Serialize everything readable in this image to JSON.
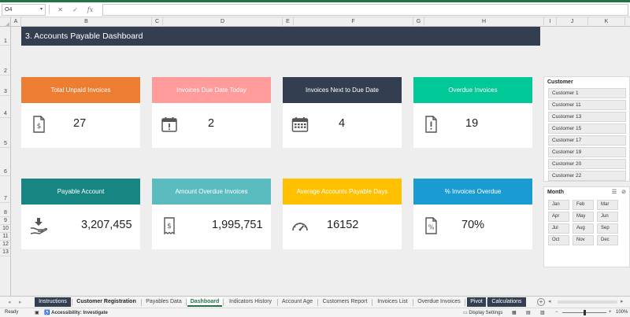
{
  "formula_bar": {
    "name_box": "O4",
    "cancel_icon": "✕",
    "enter_icon": "✓",
    "fx": "fx",
    "formula": ""
  },
  "columns": [
    "A",
    "B",
    "C",
    "D",
    "E",
    "F",
    "G",
    "H",
    "I",
    "J",
    "K"
  ],
  "rows": [
    "1",
    "2",
    "3",
    "4",
    "5",
    "6",
    "7",
    "8",
    "9",
    "10",
    "11",
    "12",
    "13"
  ],
  "dashboard": {
    "title": "3. Accounts Payable Dashboard",
    "cards": [
      {
        "label": "Total Unpaid Invoices",
        "value": "27",
        "color": "#ed7d31",
        "icon": "invoice-icon"
      },
      {
        "label": "Invoices Due Date Today",
        "value": "2",
        "color": "#ff9b9b",
        "icon": "calendar-icon"
      },
      {
        "label": "Invoices Next to Due Date",
        "value": "4",
        "color": "#333f50",
        "icon": "calendar-grid-icon"
      },
      {
        "label": "Overdue Invoices",
        "value": "19",
        "color": "#00c896",
        "icon": "alert-document-icon"
      },
      {
        "label": "Payable Account",
        "value": "3,207,455",
        "color": "#178683",
        "icon": "hand-money-icon"
      },
      {
        "label": "Amount Overdue Invoices",
        "value": "1,995,751",
        "color": "#5bbcc0",
        "icon": "receipt-icon"
      },
      {
        "label": "Average Accounts Payable Days",
        "value": "16152",
        "color": "#ffc000",
        "icon": "speedometer-icon"
      },
      {
        "label": "% Invoices Overdue",
        "value": "70%",
        "color": "#1a9cd3",
        "icon": "percent-document-icon"
      }
    ]
  },
  "slicers": {
    "customer": {
      "title": "Customer",
      "items": [
        "Customer 1",
        "Customer 11",
        "Customer 13",
        "Customer 15",
        "Customer 17",
        "Customer 19",
        "Customer 20",
        "Customer 22"
      ]
    },
    "month": {
      "title": "Month",
      "items": [
        "Jan",
        "Feb",
        "Mar",
        "Apr",
        "May",
        "Jun",
        "Jul",
        "Aug",
        "Sep",
        "Oct",
        "Nov",
        "Dec"
      ]
    }
  },
  "tabs": [
    {
      "label": "Instructions",
      "style": "dark"
    },
    {
      "label": "Customer Registration",
      "style": "bold"
    },
    {
      "label": "Payables Data",
      "style": "normal"
    },
    {
      "label": "Dashboard",
      "style": "active"
    },
    {
      "label": "Indicators History",
      "style": "normal"
    },
    {
      "label": "Account Age",
      "style": "normal"
    },
    {
      "label": "Customers Report",
      "style": "normal"
    },
    {
      "label": "Invoices List",
      "style": "normal"
    },
    {
      "label": "Overdue Invoices",
      "style": "normal"
    },
    {
      "label": "Pivot",
      "style": "dark"
    },
    {
      "label": "Calculations",
      "style": "dark"
    }
  ],
  "status_bar": {
    "ready": "Ready",
    "accessibility": "Accessibility: Investigate",
    "display_settings": "Display Settings",
    "zoom": "100%"
  }
}
